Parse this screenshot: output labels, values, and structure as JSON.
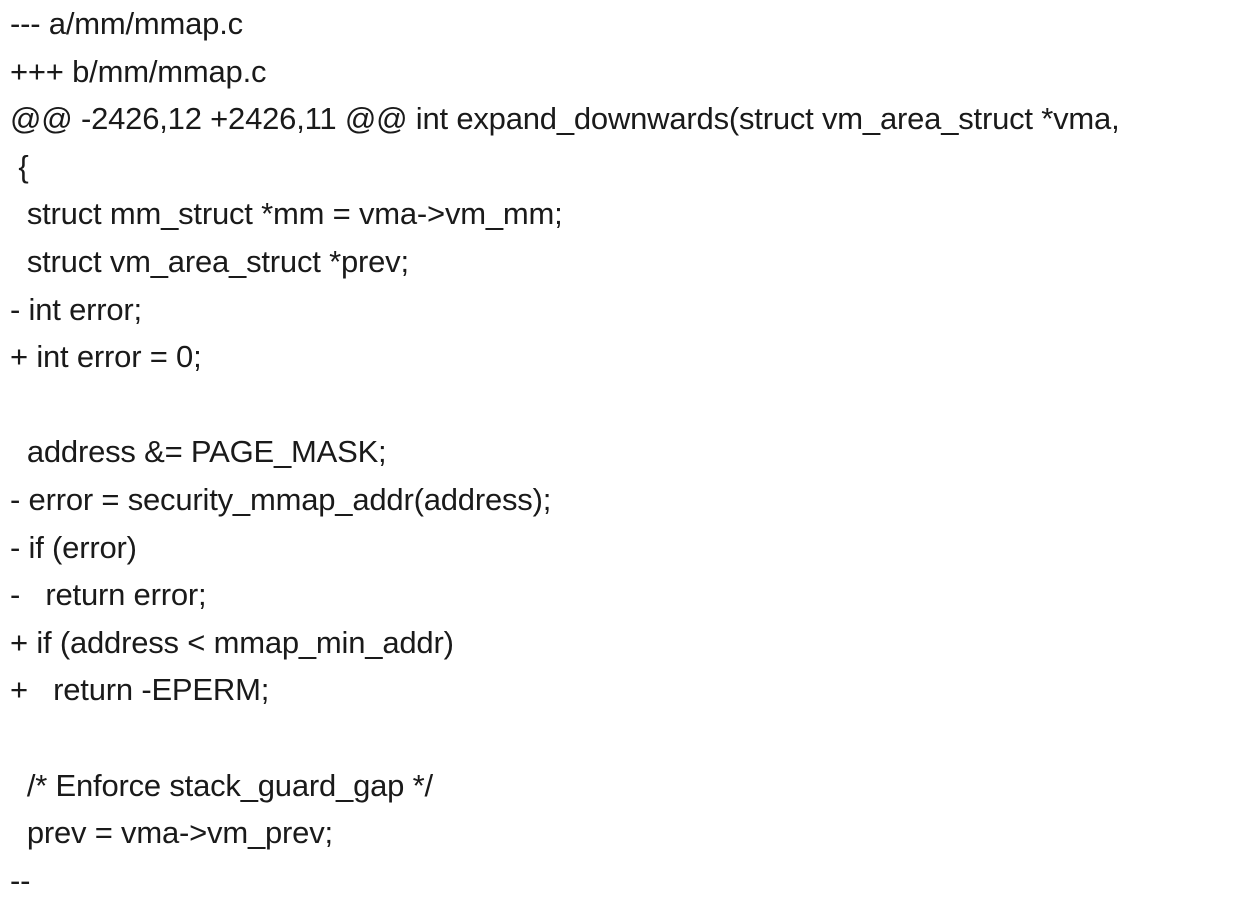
{
  "diff": {
    "lines": [
      "--- a/mm/mmap.c",
      "+++ b/mm/mmap.c",
      "@@ -2426,12 +2426,11 @@ int expand_downwards(struct vm_area_struct *vma,",
      " {",
      "  struct mm_struct *mm = vma->vm_mm;",
      "  struct vm_area_struct *prev;",
      "- int error;",
      "+ int error = 0;",
      "",
      "  address &= PAGE_MASK;",
      "- error = security_mmap_addr(address);",
      "- if (error)",
      "-   return error;",
      "+ if (address < mmap_min_addr)",
      "+   return -EPERM;",
      "",
      "  /* Enforce stack_guard_gap */",
      "  prev = vma->vm_prev;",
      "--"
    ]
  }
}
